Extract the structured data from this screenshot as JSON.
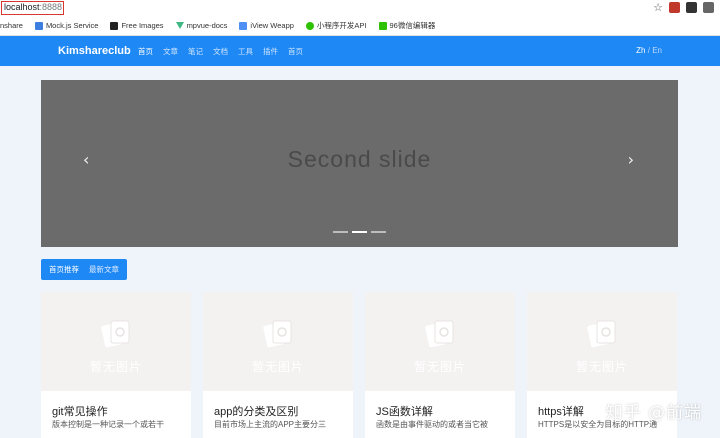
{
  "browser": {
    "url_host": "localhost",
    "url_port": ":8888",
    "bookmarks": [
      {
        "label": "nshare",
        "icon": "bookmark-icon",
        "color": "#ffffff"
      },
      {
        "label": "Mock.js Service",
        "icon": "page-icon",
        "color": "#3c7ee0"
      },
      {
        "label": "Free Images",
        "icon": "camera-icon",
        "color": "#222222"
      },
      {
        "label": "mpvue-docs",
        "icon": "vue-icon",
        "color": "#41b883"
      },
      {
        "label": "iView Weapp",
        "icon": "page-icon",
        "color": "#4d8ff5"
      },
      {
        "label": "小程序开发API",
        "icon": "wechat-icon",
        "color": "#2dc100"
      },
      {
        "label": "96微信编辑器",
        "icon": "editor-icon",
        "color": "#2dc100"
      }
    ]
  },
  "navbar": {
    "brand": "Kimshareclub",
    "links": [
      "首页",
      "文章",
      "笔记",
      "文档",
      "工具",
      "插件",
      "首页"
    ],
    "active_index": 0,
    "lang_zh": "Zh",
    "lang_sep": "/",
    "lang_en": "En"
  },
  "carousel": {
    "slide_text": "Second slide",
    "prev_glyph": "‹",
    "next_glyph": "›",
    "indicator_count": 3,
    "active_indicator": 1
  },
  "tabs": {
    "recommended": "首页推荐",
    "latest": "最新文章"
  },
  "cards": [
    {
      "placeholder": "暂无图片",
      "title": "git常见操作",
      "desc": "版本控制是一种记录一个或若干"
    },
    {
      "placeholder": "暂无图片",
      "title": "app的分类及区别",
      "desc": "目前市场上主流的APP主要分三"
    },
    {
      "placeholder": "暂无图片",
      "title": "JS函数详解",
      "desc": "函数是由事件驱动的或者当它被"
    },
    {
      "placeholder": "暂无图片",
      "title": "https详解",
      "desc": "HTTPS是以安全为目标的HTTP通"
    }
  ],
  "watermark": "知乎 @前端",
  "colors": {
    "primary": "#1e88f5",
    "carousel_bg": "#6b6b6b",
    "page_bg": "#eef4fa",
    "url_highlight": "#d9382f"
  }
}
